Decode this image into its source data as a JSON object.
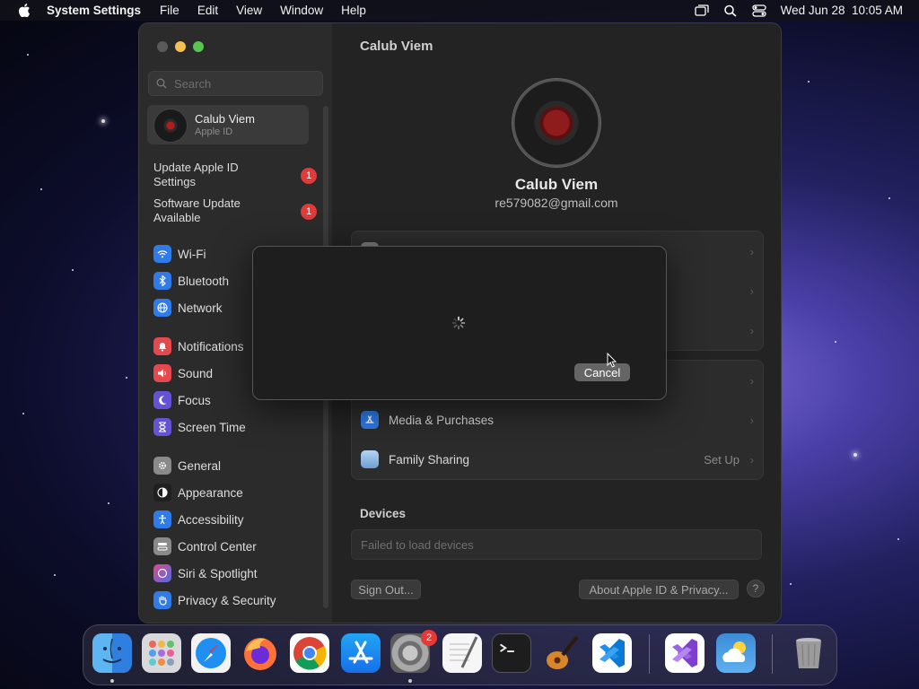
{
  "menubar": {
    "app_name": "System Settings",
    "menus": [
      "File",
      "Edit",
      "View",
      "Window",
      "Help"
    ],
    "clock": "Wed Jun 28  10:05 AM"
  },
  "sidebar": {
    "search_placeholder": "Search",
    "account": {
      "name": "Calub Viem",
      "subtitle": "Apple ID"
    },
    "notices": [
      {
        "label": "Update Apple ID Settings",
        "badge": "1"
      },
      {
        "label": "Software Update Available",
        "badge": "1"
      }
    ],
    "items": [
      {
        "label": "Wi-Fi",
        "icon": "wifi-icon",
        "color": "#2f7be8"
      },
      {
        "label": "Bluetooth",
        "icon": "bluetooth-icon",
        "color": "#2f7be8"
      },
      {
        "label": "Network",
        "icon": "globe-icon",
        "color": "#2f7be8"
      },
      {
        "label": "Notifications",
        "icon": "bell-icon",
        "color": "#e5484d"
      },
      {
        "label": "Sound",
        "icon": "speaker-icon",
        "color": "#e5484d"
      },
      {
        "label": "Focus",
        "icon": "moon-icon",
        "color": "#6553d6"
      },
      {
        "label": "Screen Time",
        "icon": "hourglass-icon",
        "color": "#6553d6"
      },
      {
        "label": "General",
        "icon": "gear-icon",
        "color": "#8a8a8a"
      },
      {
        "label": "Appearance",
        "icon": "appearance-icon",
        "color": "#1f1f1f"
      },
      {
        "label": "Accessibility",
        "icon": "accessibility-icon",
        "color": "#2f7be8"
      },
      {
        "label": "Control Center",
        "icon": "control-center-icon",
        "color": "#8a8a8a"
      },
      {
        "label": "Siri & Spotlight",
        "icon": "siri-icon",
        "color": "#c04ad6"
      },
      {
        "label": "Privacy & Security",
        "icon": "hand-icon",
        "color": "#2f7be8"
      }
    ]
  },
  "main": {
    "title": "Calub Viem",
    "profile_name": "Calub Viem",
    "profile_email": "re579082@gmail.com",
    "rows_group2": [
      {
        "label": "Media & Purchases",
        "icon": "app-store-icon",
        "color": "#2f7be8",
        "aux": ""
      },
      {
        "label": "Family Sharing",
        "icon": "family-icon",
        "color": "#8bb8e8",
        "aux": "Set Up"
      }
    ],
    "devices_title": "Devices",
    "devices_status": "Failed to load devices",
    "sign_out_label": "Sign Out...",
    "about_label": "About Apple ID & Privacy...",
    "help_label": "?"
  },
  "dialog": {
    "cancel_label": "Cancel"
  },
  "dock": {
    "apps": [
      {
        "name": "finder-icon",
        "color": "#3a8ee6"
      },
      {
        "name": "launchpad-icon",
        "color": "#c9c9c9"
      },
      {
        "name": "safari-icon",
        "color": "#1e8ff0"
      },
      {
        "name": "firefox-icon",
        "color": "#ff7139"
      },
      {
        "name": "chrome-icon",
        "color": "#ffffff"
      },
      {
        "name": "app-store-icon",
        "color": "#1b8cf2"
      },
      {
        "name": "system-settings-icon",
        "color": "#8c8c8c",
        "badge": "2"
      },
      {
        "name": "textedit-icon",
        "color": "#f4f4f4"
      },
      {
        "name": "terminal-icon",
        "color": "#1d1d1d"
      },
      {
        "name": "garageband-icon",
        "color": "#2b2b2b"
      },
      {
        "name": "vscode-icon",
        "color": "#ffffff"
      },
      {
        "name": "visual-studio-icon",
        "color": "#ffffff"
      },
      {
        "name": "weather-icon",
        "color": "#3b8cd6"
      },
      {
        "name": "trash-icon",
        "color": "#9a9a9a"
      }
    ]
  }
}
